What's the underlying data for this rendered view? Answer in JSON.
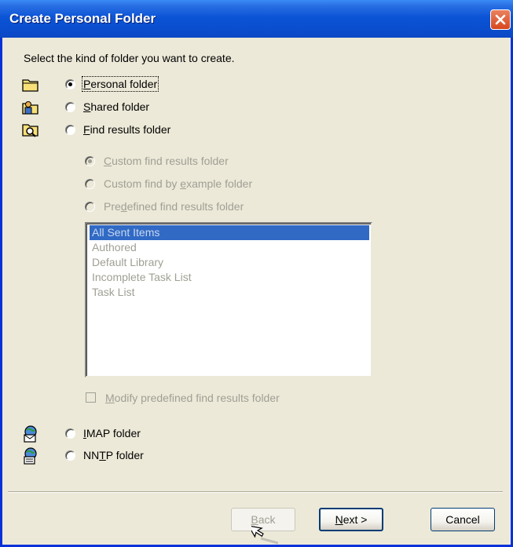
{
  "window": {
    "title": "Create Personal Folder",
    "close_icon": "close-icon"
  },
  "prompt": "Select the kind of folder you want to create.",
  "folder_types": [
    {
      "label_u": "P",
      "label_rest": "ersonal folder",
      "checked": true,
      "icon": "personal-folder-icon"
    },
    {
      "label_u": "S",
      "label_rest": "hared folder",
      "checked": false,
      "icon": "shared-folder-icon"
    },
    {
      "label_u": "F",
      "label_rest": "ind results folder",
      "checked": false,
      "icon": "find-results-folder-icon"
    }
  ],
  "find_options": [
    {
      "pre": "",
      "u": "C",
      "post": "ustom find results folder",
      "checked": true
    },
    {
      "pre": "Custom find by ",
      "u": "e",
      "post": "xample folder",
      "checked": false
    },
    {
      "pre": "Pre",
      "u": "d",
      "post": "efined find results folder",
      "checked": false
    }
  ],
  "predefined_list": {
    "items": [
      "All Sent Items",
      "Authored",
      "Default Library",
      "Incomplete Task List",
      "Task List"
    ],
    "selected_index": 0
  },
  "modify_checkbox": {
    "u": "M",
    "post": "odify predefined find results folder",
    "checked": false
  },
  "other_types": [
    {
      "u": "I",
      "post": "MAP folder",
      "pre": "",
      "checked": false,
      "icon": "imap-folder-icon"
    },
    {
      "pre": "NN",
      "u": "T",
      "post": "P folder",
      "checked": false,
      "icon": "nntp-folder-icon"
    }
  ],
  "buttons": {
    "back": {
      "u": "B",
      "post": "ack",
      "enabled": false
    },
    "next": {
      "u": "N",
      "post": "ext >",
      "enabled": true
    },
    "cancel": {
      "label": "Cancel",
      "enabled": true
    }
  },
  "colors": {
    "titlebar": "#0b54d6",
    "dialog_bg": "#ece9d8",
    "selection": "#316ac5",
    "disabled_text": "#a09f94"
  }
}
